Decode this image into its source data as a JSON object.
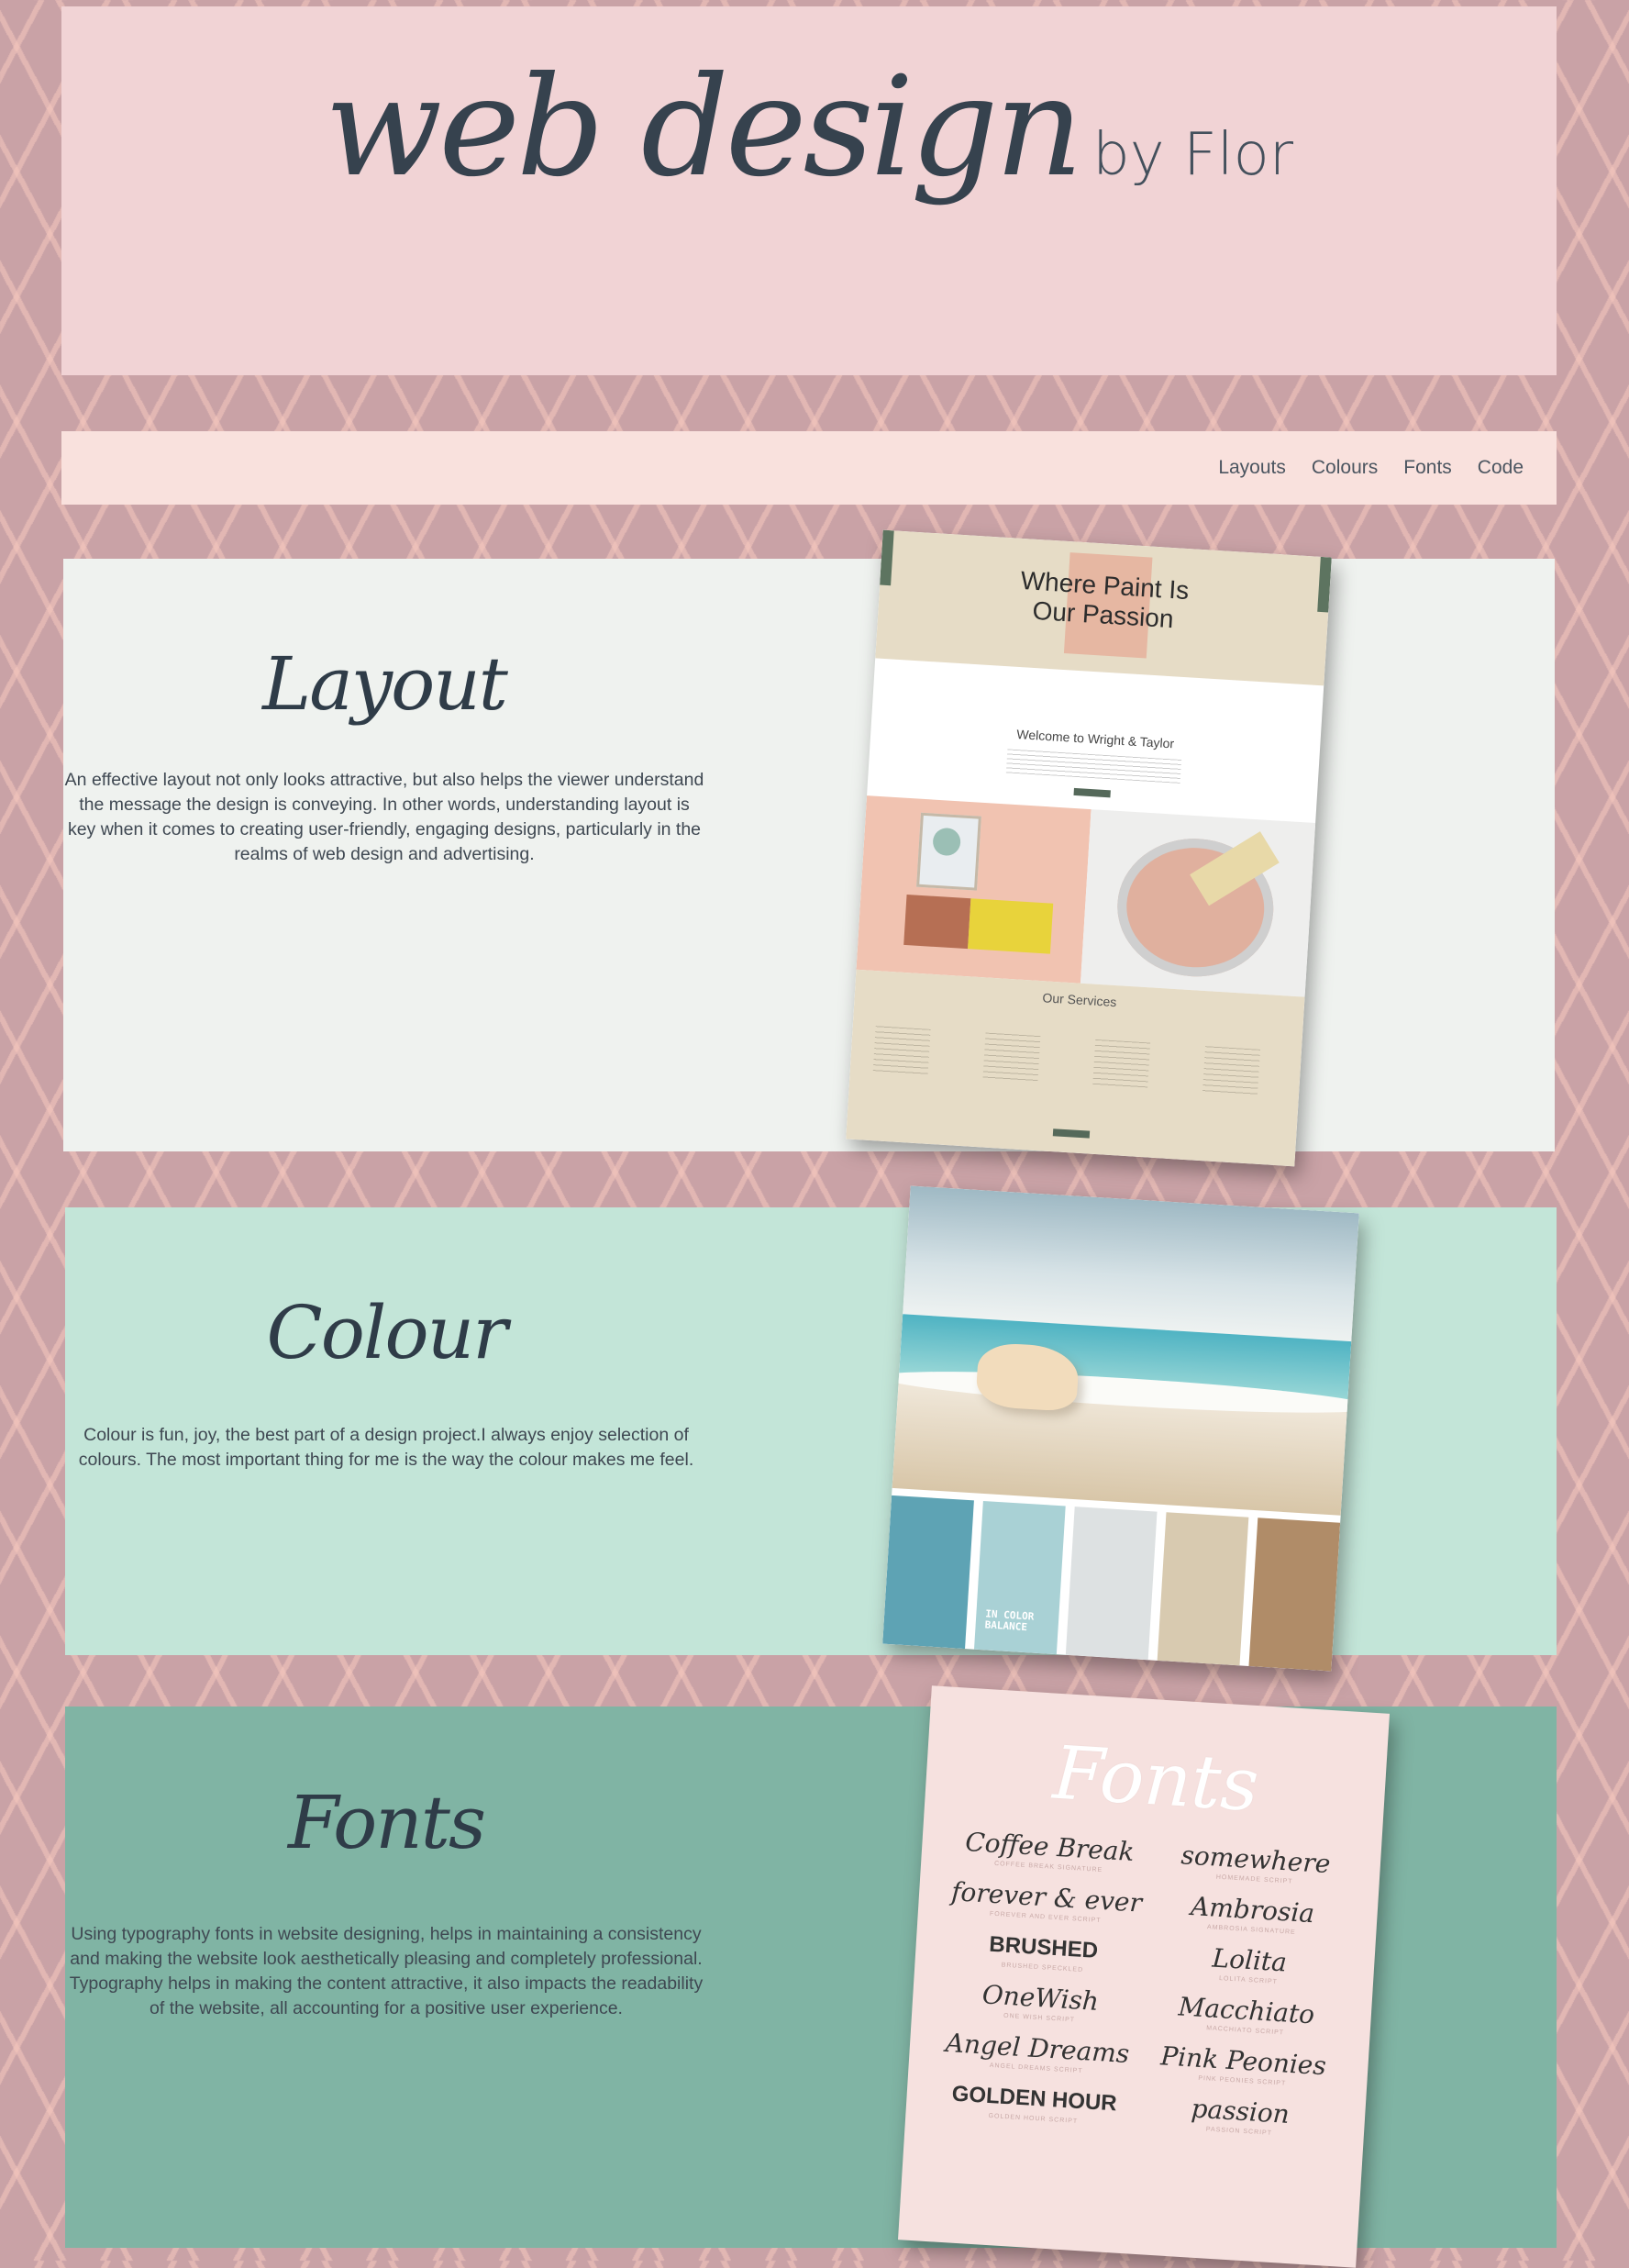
{
  "header": {
    "title_script": "web design",
    "title_suffix": "by Flor"
  },
  "nav": {
    "links": [
      "Layouts",
      "Colours",
      "Fonts",
      "Code"
    ]
  },
  "layout": {
    "title": "Layout",
    "body": "An effective layout not only looks attractive, but also helps the viewer understand the message the design is conveying. In other words, understanding layout is key when it comes to creating user-friendly, engaging designs, particularly in the realms of web design and advertising.",
    "image": {
      "headline": "Where Paint Is Our Passion",
      "welcome": "Welcome to Wright & Taylor",
      "services_title": "Our Services"
    }
  },
  "colour": {
    "title": "Colour",
    "body": "Colour is fun, joy, the best part of a design project.I always enjoy selection of colours. The most important thing for me is the way the colour makes me feel.",
    "image": {
      "label": "IN COLOR BALANCE",
      "swatches": [
        "#5ea3b4",
        "#a9d1d5",
        "#dde1e2",
        "#d8cab0",
        "#b08c68"
      ]
    }
  },
  "fonts": {
    "title": "Fonts",
    "body": "Using typography fonts in website designing, helps in maintaining a consistency and making the website look aesthetically pleasing and completely professional. Typography helps in making the content attractive, it also impacts the readability of the website, all accounting for a positive user experience.",
    "image": {
      "title": "Fonts",
      "samples": [
        {
          "sample": "Coffee Break",
          "caption": "COFFEE BREAK SIGNATURE",
          "style": "script"
        },
        {
          "sample": "somewhere",
          "caption": "HOMEMADE SCRIPT",
          "style": "script"
        },
        {
          "sample": "forever & ever",
          "caption": "FOREVER AND EVER SCRIPT",
          "style": "script"
        },
        {
          "sample": "Ambrosia",
          "caption": "AMBROSIA SIGNATURE",
          "style": "script"
        },
        {
          "sample": "BRUSHED",
          "caption": "BRUSHED SPECKLED",
          "style": "bold"
        },
        {
          "sample": "Lolita",
          "caption": "LOLITA SCRIPT",
          "style": "script"
        },
        {
          "sample": "OneWish",
          "caption": "ONE WISH SCRIPT",
          "style": "script"
        },
        {
          "sample": "Macchiato",
          "caption": "MACCHIATO SCRIPT",
          "style": "script"
        },
        {
          "sample": "Angel Dreams",
          "caption": "ANGEL DREAMS SCRIPT",
          "style": "script"
        },
        {
          "sample": "Pink Peonies",
          "caption": "PINK PEONIES SCRIPT",
          "style": "script"
        },
        {
          "sample": "GOLDEN HOUR",
          "caption": "GOLDEN HOUR SCRIPT",
          "style": "bold"
        },
        {
          "sample": "passion",
          "caption": "PASSION SCRIPT",
          "style": "script"
        }
      ]
    }
  }
}
